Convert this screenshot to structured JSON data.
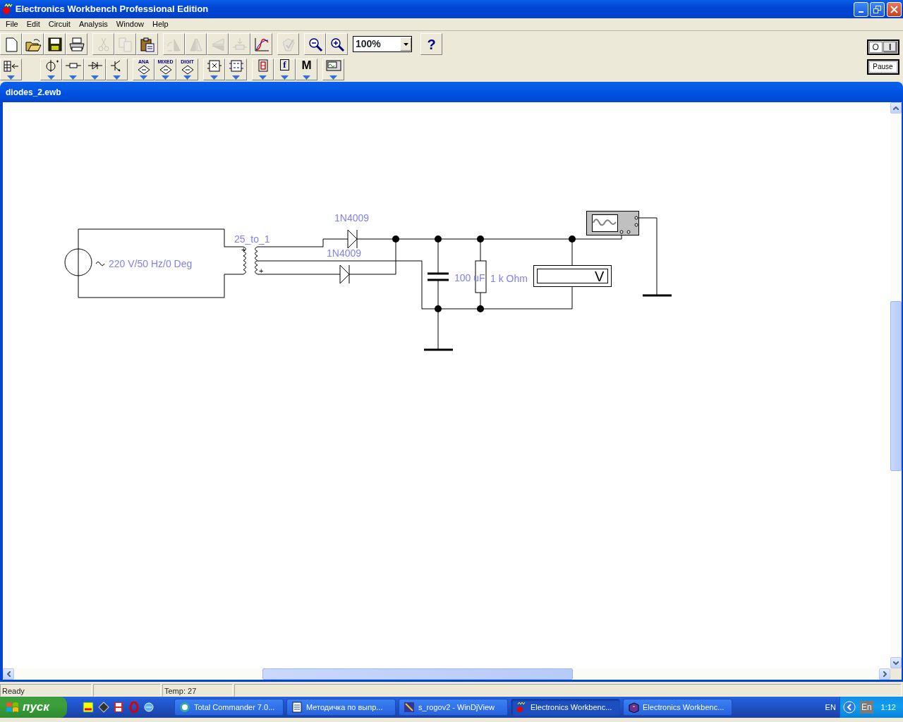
{
  "window": {
    "title": "Electronics Workbench Professional Edition"
  },
  "menu": [
    "File",
    "Edit",
    "Circuit",
    "Analysis",
    "Window",
    "Help"
  ],
  "toolbar": {
    "row1": [
      [
        {
          "kind": "new",
          "disabled": false
        },
        {
          "kind": "open",
          "disabled": false
        },
        {
          "kind": "save",
          "disabled": false
        },
        {
          "kind": "print",
          "disabled": false
        }
      ],
      [
        {
          "kind": "cut",
          "disabled": true
        },
        {
          "kind": "copy",
          "disabled": true
        },
        {
          "kind": "paste",
          "disabled": false
        }
      ],
      [
        {
          "kind": "rotate",
          "disabled": true
        },
        {
          "kind": "flip_h",
          "disabled": true
        },
        {
          "kind": "flip_v",
          "disabled": true
        },
        {
          "kind": "props",
          "disabled": true
        },
        {
          "kind": "graph",
          "disabled": false
        }
      ],
      [
        {
          "kind": "subcircuit",
          "disabled": true
        }
      ],
      [
        {
          "kind": "zoom_out",
          "disabled": false
        },
        {
          "kind": "zoom_in",
          "disabled": false
        }
      ]
    ],
    "zoom": {
      "value": "100%"
    },
    "help": {
      "label": "?"
    },
    "row2": [
      [
        {
          "kind": "parts_bin"
        }
      ],
      [
        {
          "kind": "sources"
        },
        {
          "kind": "basic"
        },
        {
          "kind": "diodes"
        },
        {
          "kind": "transistors"
        }
      ],
      [
        {
          "kind": "chip",
          "label": "ANA"
        },
        {
          "kind": "chip",
          "label": "MIXED"
        },
        {
          "kind": "chip",
          "label": "DIGIT"
        }
      ],
      [
        {
          "kind": "logic"
        },
        {
          "kind": "digital"
        }
      ],
      [
        {
          "kind": "indicators"
        },
        {
          "kind": "controls",
          "label": "f"
        },
        {
          "kind": "misc",
          "label": "M"
        }
      ],
      [
        {
          "kind": "instruments"
        }
      ]
    ]
  },
  "sim_controls": {
    "switch": {
      "off_label": "O",
      "on_label": "I",
      "on": true
    },
    "pause": {
      "label": "Pause"
    }
  },
  "document": {
    "title": "diodes_2.ewb"
  },
  "circuit": {
    "source_label": "220 V/50 Hz/0 Deg",
    "transformer_label": "25_to_1",
    "transformer_marks": [
      "+",
      "+"
    ],
    "diodes": [
      {
        "label": "1N4009"
      },
      {
        "label": "1N4009"
      }
    ],
    "capacitor_label": "100 uF",
    "resistor_label": "1 k Ohm",
    "voltmeter_label": "V"
  },
  "status_bar": {
    "message": "Ready",
    "temperature": "Temp: 27"
  },
  "taskbar": {
    "start": {
      "label": "пуск"
    },
    "quick_launch": [
      {
        "kind": "avr"
      },
      {
        "kind": "chip"
      },
      {
        "kind": "floppy"
      },
      {
        "kind": "opera"
      },
      {
        "kind": "browser"
      }
    ],
    "tasks": [
      {
        "kind": "tc",
        "label": "Total Commander 7.0...",
        "selected": false
      },
      {
        "kind": "word",
        "label": "Методичка по выпр...",
        "selected": false
      },
      {
        "kind": "djview",
        "label": "s_rogov2 - WinDjView",
        "selected": false
      },
      {
        "kind": "ewb",
        "label": "Electronics Workbenc...",
        "selected": true
      },
      {
        "kind": "help",
        "label": "Electronics Workbenc...",
        "selected": false
      }
    ],
    "tray": {
      "language": "EN",
      "layout": "En",
      "time": "1:12"
    }
  }
}
